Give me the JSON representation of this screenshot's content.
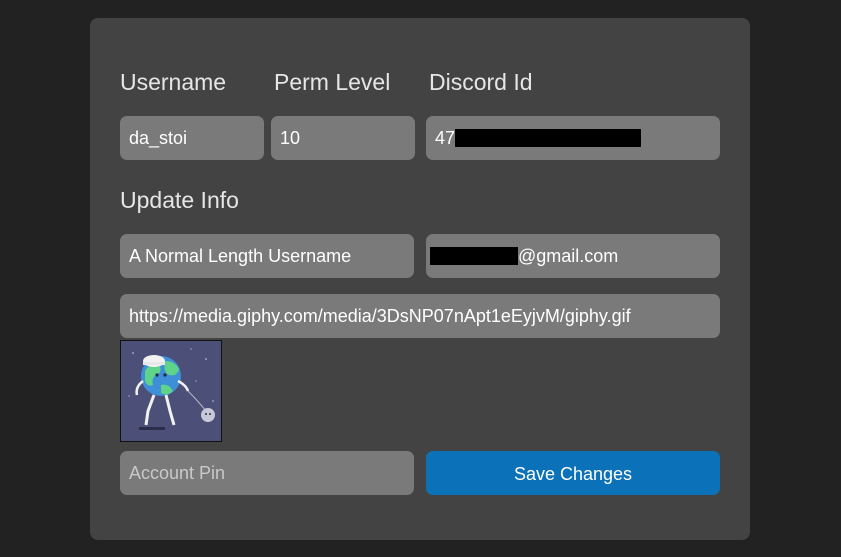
{
  "labels": {
    "username": "Username",
    "perm_level": "Perm Level",
    "discord_id": "Discord Id",
    "update_info": "Update Info"
  },
  "current": {
    "username": "da_stoi",
    "perm_level": "10",
    "discord_id_visible_prefix": "47"
  },
  "update": {
    "display_name": "A Normal Length Username",
    "email_suffix": "@gmail.com",
    "avatar_url": "https://media.giphy.com/media/3DsNP07nApt1eEyjvM/giphy.gif",
    "avatar_preview_icon": "walking-earth-gif"
  },
  "pin": {
    "placeholder": "Account Pin"
  },
  "actions": {
    "save_label": "Save Changes"
  },
  "colors": {
    "background": "#222222",
    "card": "#434343",
    "field": "#7a7a7a",
    "accent": "#0b72b9"
  }
}
